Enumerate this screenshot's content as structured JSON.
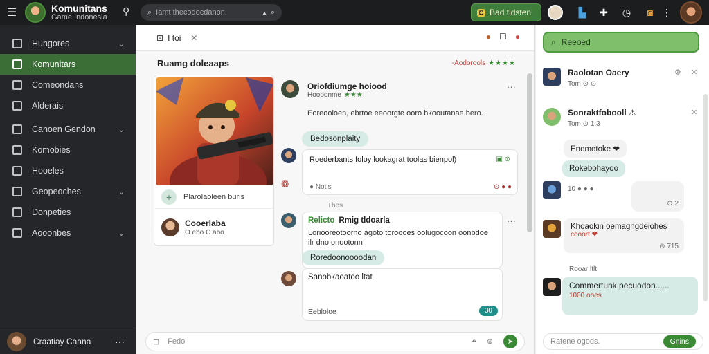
{
  "topbar": {
    "brand_title": "Komunitans",
    "brand_subtitle": "Game Indonesia",
    "search_placeholder": "Iamt thecodocdanon.",
    "cta_label": "Bad tidsten",
    "cta_icon": "chat-icon",
    "icons": [
      "search-icon",
      "bell-icon",
      "flag-icon",
      "puzzle-icon",
      "clock-icon",
      "shield-icon",
      "more-icon"
    ]
  },
  "sidebar": {
    "items": [
      {
        "label": "Hungores",
        "chevron": true
      },
      {
        "label": "Komunitars",
        "chevron": false,
        "active": true
      },
      {
        "label": "Comeondans",
        "chevron": false
      },
      {
        "label": "Alderais",
        "chevron": false
      },
      {
        "label": "Canoen Gendon",
        "chevron": true
      },
      {
        "label": "Komobies",
        "chevron": false
      },
      {
        "label": "Hooeles",
        "chevron": false
      },
      {
        "label": "Geopeoches",
        "chevron": true
      },
      {
        "label": "Donpeties",
        "chevron": false
      },
      {
        "label": "Aooonbes",
        "chevron": true
      }
    ],
    "footer": {
      "name": "Craatiay Caana",
      "more": "···"
    }
  },
  "main": {
    "tab_label": "I toi",
    "section_title": "Ruamg doleaaps",
    "section_right": "-Aodorools",
    "section_stars": "★★★★",
    "card": {
      "row1": "Plarolaoleen buris",
      "name": "Cooerlaba",
      "meta": "O ebo C abo"
    },
    "post": {
      "name": "Oriofdiumge hoiood",
      "meta": "Hoooonme",
      "stars": "★★★",
      "text": "Eoreooloen, ebrtoe eeoorgte ooro bkooutanae bero.",
      "chip": "Bedosonplaity"
    },
    "bubble1": {
      "text": "Roederbants foloy lookagrat toolas bienpol)",
      "icons": "▣ ⊙",
      "footer": "Notis",
      "right": "⊙ ● ●"
    },
    "day_separator": "Thes",
    "bubble2": {
      "tag": "Relicto",
      "title": "Rmig tldoarla",
      "text": "Loriooreotoorno agoto toroooes oolugocoon oonbdoe ilr dno onootonn",
      "chip": "Roredoonoooodan"
    },
    "bubble3": {
      "title": "Sanobkaoatoo ltat",
      "footer": "Eebloloe",
      "badge": "30"
    },
    "compose_placeholder": "Fedo"
  },
  "rpanel": {
    "search_label": "Reeoed",
    "items": [
      {
        "name": "Raolotan Oaery",
        "meta": "Tom ⊙ ⊙"
      },
      {
        "name": "Sonraktfobooll ⚠",
        "meta": "Tom ⊙ 1:3"
      }
    ],
    "bubbles": [
      {
        "text": "Enomotoke ❤",
        "kind": "w"
      },
      {
        "text": "Rokebohayoo",
        "kind": "g"
      },
      {
        "text": "10 ● ● ●",
        "kind": "w"
      }
    ],
    "msg1": {
      "title": "Khoaokin oemaghgdeiohes",
      "sub": "cooort ❤",
      "time": "⊙ 715"
    },
    "msg_meta": "Rooar ltlt",
    "msg2": {
      "title": "Commertunk pecuodon......",
      "sub": "1000 ooes",
      "time": ""
    },
    "compose_placeholder": "Ratene ogods.",
    "compose_button": "Gnins"
  },
  "colors": {
    "sidebar_bg": "#24262a",
    "accent_green": "#3b6e36",
    "chip_teal": "#d7ebe6",
    "topbar_bg": "#1c1d1f"
  }
}
